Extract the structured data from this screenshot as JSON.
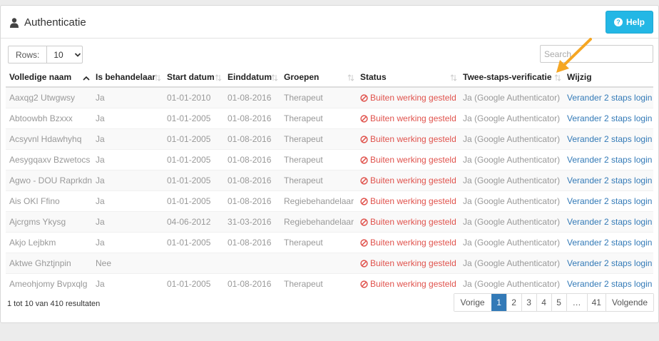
{
  "panel": {
    "title": "Authenticatie",
    "help_label": "Help"
  },
  "controls": {
    "rows_label": "Rows:",
    "rows_value": "10",
    "search_placeholder": "Search"
  },
  "table": {
    "headers": [
      "Volledige naam",
      "Is behandelaar",
      "Start datum",
      "Einddatum",
      "Groepen",
      "Status",
      "Twee-staps-verificatie",
      "Wijzig"
    ],
    "rows": [
      {
        "name": "Aaxqg2 Utwgwsy",
        "behandelaar": "Ja",
        "start": "01-01-2010",
        "eind": "01-08-2016",
        "groep": "Therapeut",
        "status": "Buiten werking gesteld",
        "twofa": "Ja (Google Authenticator)",
        "action": "Verander 2 staps login"
      },
      {
        "name": "Abtoowbh Bzxxx",
        "behandelaar": "Ja",
        "start": "01-01-2005",
        "eind": "01-08-2016",
        "groep": "Therapeut",
        "status": "Buiten werking gesteld",
        "twofa": "Ja (Google Authenticator)",
        "action": "Verander 2 staps login"
      },
      {
        "name": "Acsyvnl Hdawhyhq",
        "behandelaar": "Ja",
        "start": "01-01-2005",
        "eind": "01-08-2016",
        "groep": "Therapeut",
        "status": "Buiten werking gesteld",
        "twofa": "Ja (Google Authenticator)",
        "action": "Verander 2 staps login"
      },
      {
        "name": "Aesygqaxv Bzwetocs",
        "behandelaar": "Ja",
        "start": "01-01-2005",
        "eind": "01-08-2016",
        "groep": "Therapeut",
        "status": "Buiten werking gesteld",
        "twofa": "Ja (Google Authenticator)",
        "action": "Verander 2 staps login"
      },
      {
        "name": "Agwo - DOU Raprkdn",
        "behandelaar": "Ja",
        "start": "01-01-2005",
        "eind": "01-08-2016",
        "groep": "Therapeut",
        "status": "Buiten werking gesteld",
        "twofa": "Ja (Google Authenticator)",
        "action": "Verander 2 staps login"
      },
      {
        "name": "Ais OKI Ffino",
        "behandelaar": "Ja",
        "start": "01-01-2005",
        "eind": "01-08-2016",
        "groep": "Regiebehandelaar",
        "status": "Buiten werking gesteld",
        "twofa": "Ja (Google Authenticator)",
        "action": "Verander 2 staps login"
      },
      {
        "name": "Ajcrgms Ykysg",
        "behandelaar": "Ja",
        "start": "04-06-2012",
        "eind": "31-03-2016",
        "groep": "Regiebehandelaar",
        "status": "Buiten werking gesteld",
        "twofa": "Ja (Google Authenticator)",
        "action": "Verander 2 staps login"
      },
      {
        "name": "Akjo Lejbkm",
        "behandelaar": "Ja",
        "start": "01-01-2005",
        "eind": "01-08-2016",
        "groep": "Therapeut",
        "status": "Buiten werking gesteld",
        "twofa": "Ja (Google Authenticator)",
        "action": "Verander 2 staps login"
      },
      {
        "name": "Aktwe Ghztjnpin",
        "behandelaar": "Nee",
        "start": "",
        "eind": "",
        "groep": "",
        "status": "Buiten werking gesteld",
        "twofa": "Ja (Google Authenticator)",
        "action": "Verander 2 staps login"
      },
      {
        "name": "Ameohjomy Bvpxqlg",
        "behandelaar": "Ja",
        "start": "01-01-2005",
        "eind": "01-08-2016",
        "groep": "Therapeut",
        "status": "Buiten werking gesteld",
        "twofa": "Ja (Google Authenticator)",
        "action": "Verander 2 staps login"
      }
    ]
  },
  "footer": {
    "result_info": "1 tot 10 van 410 resultaten",
    "pagination": [
      "Vorige",
      "1",
      "2",
      "3",
      "4",
      "5",
      "…",
      "41",
      "Volgende"
    ],
    "active_page": "1"
  },
  "colors": {
    "accent": "#23b7e5",
    "link": "#337ab7",
    "status_red": "#e0534d",
    "annotation_arrow": "#f5a623"
  }
}
